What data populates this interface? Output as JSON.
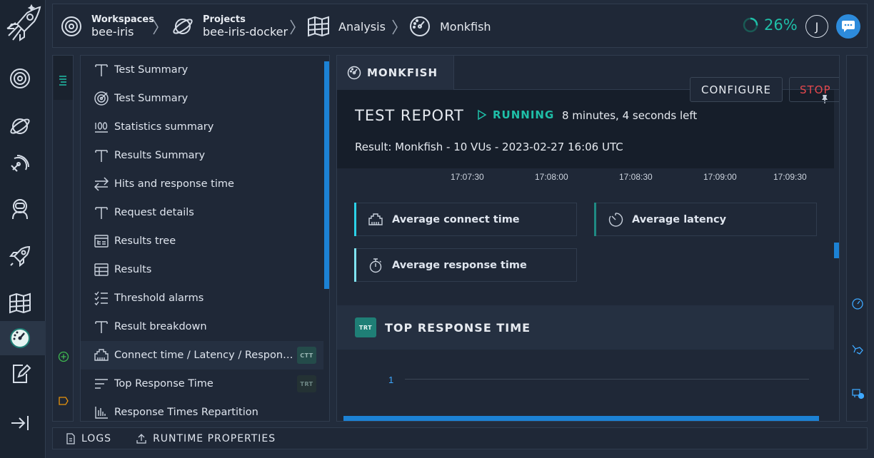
{
  "header": {
    "breadcrumb": [
      {
        "small": "Workspaces",
        "label": "bee-iris",
        "icon": "target-icon"
      },
      {
        "small": "Projects",
        "label": "bee-iris-docker",
        "icon": "planet-icon"
      },
      {
        "label": "Analysis",
        "icon": "map-icon"
      },
      {
        "label": "Monkfish",
        "icon": "gauge-icon"
      }
    ],
    "progress": "26%",
    "progress_value": 0.26,
    "avatar_initial": "J"
  },
  "rail": {
    "items": [
      "workspaces-icon",
      "projects-icon",
      "radar-icon",
      "astronaut-icon",
      "rocket-icon",
      "map-icon",
      "gauge-icon",
      "edit-icon",
      "collapse-icon"
    ],
    "active": "gauge-icon"
  },
  "items": [
    {
      "label": "Test Summary",
      "icon": "text-icon"
    },
    {
      "label": "Test Summary",
      "icon": "target-icon"
    },
    {
      "label": "Statistics summary",
      "icon": "hundred-icon"
    },
    {
      "label": "Results Summary",
      "icon": "text-icon"
    },
    {
      "label": "Hits and response time",
      "icon": "arrows-icon"
    },
    {
      "label": "Request details",
      "icon": "text-icon"
    },
    {
      "label": "Results tree",
      "icon": "tree-icon"
    },
    {
      "label": "Results",
      "icon": "table-icon"
    },
    {
      "label": "Threshold alarms",
      "icon": "checklist-icon"
    },
    {
      "label": "Result breakdown",
      "icon": "text-icon"
    },
    {
      "label": "Connect time / Latency / Response time",
      "icon": "ethernet-icon",
      "tag": "CTT"
    },
    {
      "label": "Top Response Time",
      "icon": "sort-icon",
      "tag": "TRT"
    },
    {
      "label": "Response Times Repartition",
      "icon": "bars-icon"
    }
  ],
  "main": {
    "tab": "MONKFISH",
    "report_title": "TEST REPORT",
    "status": "RUNNING",
    "time_left": "8 minutes, 4 seconds left",
    "configure": "CONFIGURE",
    "stop": "STOP",
    "result": "Result: Monkfish - 10 VUs - 2023-02-27 16:06 UTC",
    "time_ticks": [
      "17:07:30",
      "17:08:00",
      "17:08:30",
      "17:09:00",
      "17:09:30"
    ],
    "cards": [
      {
        "label": "Average connect time",
        "color": "#2bd1e8"
      },
      {
        "label": "Average latency",
        "color": "#1f8a83"
      },
      {
        "label": "Average response time",
        "color": "#7fe3f0"
      }
    ],
    "section_tag": "TRT",
    "section_title": "TOP RESPONSE TIME",
    "chart_y_label": "1"
  },
  "footer": {
    "logs": "LOGS",
    "runtime": "RUNTIME PROPERTIES"
  },
  "colors": {
    "accent": "#1fbfa8",
    "blue": "#1c82d4",
    "danger": "#e5484d"
  }
}
